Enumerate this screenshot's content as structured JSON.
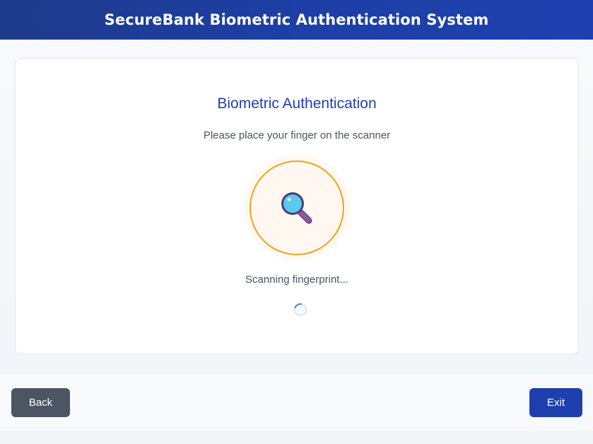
{
  "header": {
    "title": "SecureBank Biometric Authentication System"
  },
  "auth": {
    "title": "Biometric Authentication",
    "instruction": "Please place your finger on the scanner",
    "status": "Scanning fingerprint...",
    "scanner_icon": "magnifying-glass-icon"
  },
  "footer": {
    "back_label": "Back",
    "exit_label": "Exit"
  },
  "colors": {
    "header_bg": "#1e40af",
    "accent": "#1e40af",
    "scanner_ring": "#f0a21b",
    "back_button": "#4b5563",
    "exit_button": "#1e40af",
    "spinner": "#3b82f6"
  }
}
